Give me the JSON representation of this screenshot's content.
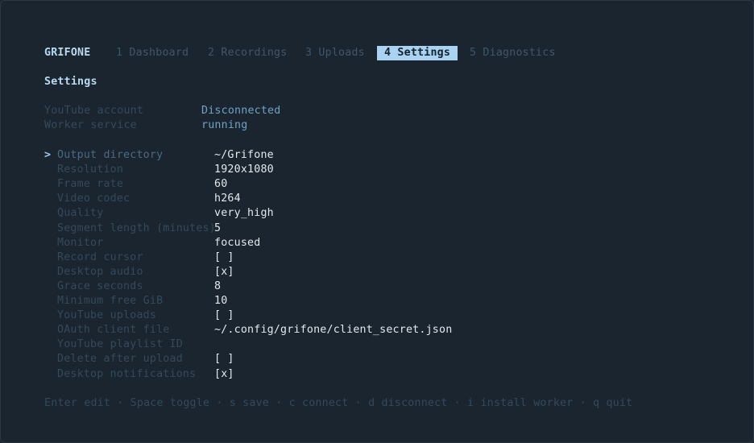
{
  "header": {
    "brand": "GRIFONE",
    "tabs": [
      {
        "label": "1 Dashboard",
        "active": false
      },
      {
        "label": "2 Recordings",
        "active": false
      },
      {
        "label": "3 Uploads",
        "active": false
      },
      {
        "label": "4 Settings",
        "active": true
      },
      {
        "label": "5 Diagnostics",
        "active": false
      }
    ]
  },
  "page": {
    "title": "Settings"
  },
  "status": [
    {
      "label": "YouTube account",
      "value": "Disconnected"
    },
    {
      "label": "Worker service",
      "value": "running"
    }
  ],
  "settings": {
    "cursor": ">",
    "items": [
      {
        "label": "Output directory",
        "value": "~/Grifone"
      },
      {
        "label": "Resolution",
        "value": "1920x1080"
      },
      {
        "label": "Frame rate",
        "value": "60"
      },
      {
        "label": "Video codec",
        "value": "h264"
      },
      {
        "label": "Quality",
        "value": "very_high"
      },
      {
        "label": "Segment length (minutes)",
        "value": "5"
      },
      {
        "label": "Monitor",
        "value": "focused"
      },
      {
        "label": "Record cursor",
        "value": "[ ]"
      },
      {
        "label": "Desktop audio",
        "value": "[x]"
      },
      {
        "label": "Grace seconds",
        "value": "8"
      },
      {
        "label": "Minimum free GiB",
        "value": "10"
      },
      {
        "label": "YouTube uploads",
        "value": "[ ]"
      },
      {
        "label": "OAuth client file",
        "value": "~/.config/grifone/client_secret.json"
      },
      {
        "label": "YouTube playlist ID",
        "value": ""
      },
      {
        "label": "Delete after upload",
        "value": "[ ]"
      },
      {
        "label": "Desktop notifications",
        "value": "[x]"
      }
    ]
  },
  "footer": {
    "hints": "Enter edit · Space toggle · s save · c connect · d disconnect · i install worker · q quit"
  },
  "colors": {
    "background": "#1a252f",
    "accent": "#a9d3f0",
    "dim_text": "#34495b",
    "status_value": "#6fa2c6"
  }
}
